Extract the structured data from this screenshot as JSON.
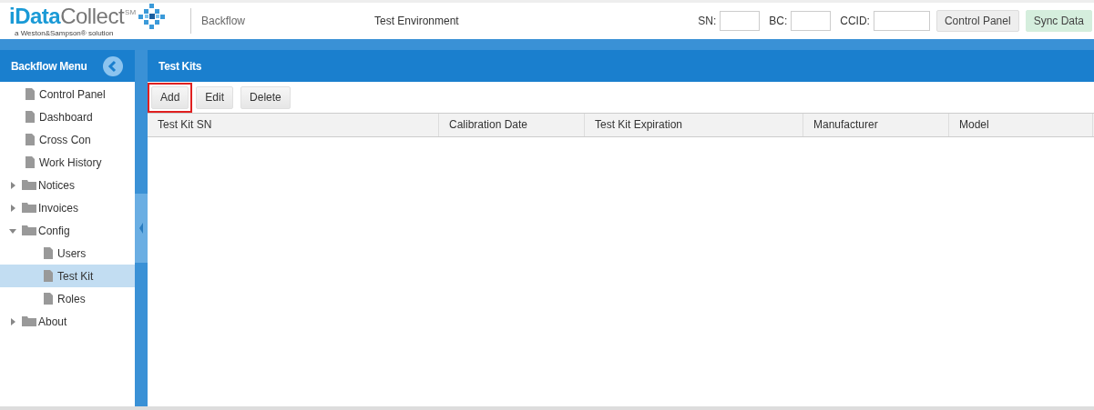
{
  "logo": {
    "brand_bold": "iData",
    "brand_light": "Collect",
    "service_mark": "SM",
    "tagline": "a Weston&Sampson® solution"
  },
  "header": {
    "module": "Backflow",
    "environment": "Test Environment",
    "fields": [
      {
        "label": "SN:"
      },
      {
        "label": "BC:"
      },
      {
        "label": "CCID:"
      }
    ],
    "buttons": [
      {
        "label": "Control Panel",
        "kind": "default"
      },
      {
        "label": "Sync Data",
        "kind": "success"
      }
    ]
  },
  "sidebar": {
    "title": "Backflow Menu",
    "items": [
      {
        "label": "Control Panel",
        "kind": "page",
        "selected": false
      },
      {
        "label": "Dashboard",
        "kind": "page",
        "selected": false
      },
      {
        "label": "Cross Con",
        "kind": "page",
        "selected": false
      },
      {
        "label": "Work History",
        "kind": "page",
        "selected": false
      },
      {
        "label": "Notices",
        "kind": "folder",
        "expanded": false,
        "selected": false
      },
      {
        "label": "Invoices",
        "kind": "folder",
        "expanded": false,
        "selected": false
      },
      {
        "label": "Config",
        "kind": "folder",
        "expanded": true,
        "selected": false,
        "children": [
          {
            "label": "Users",
            "kind": "page",
            "selected": false
          },
          {
            "label": "Test Kit",
            "kind": "page",
            "selected": true
          },
          {
            "label": "Roles",
            "kind": "page",
            "selected": false
          }
        ]
      },
      {
        "label": "About",
        "kind": "folder",
        "expanded": false,
        "selected": false
      }
    ]
  },
  "panel": {
    "title": "Test Kits",
    "toolbar": [
      {
        "label": "Add",
        "highlighted": true
      },
      {
        "label": "Edit",
        "highlighted": false
      },
      {
        "label": "Delete",
        "highlighted": false
      }
    ],
    "table": {
      "columns": [
        "Test Kit SN",
        "Calibration Date",
        "Test Kit Expiration",
        "Manufacturer",
        "Model"
      ]
    }
  }
}
